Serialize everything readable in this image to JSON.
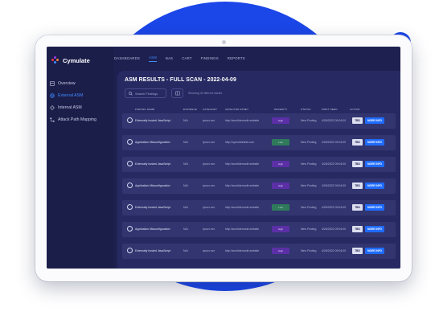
{
  "app": {
    "name": "Cymulate"
  },
  "colors": {
    "accent": "#3f8cff",
    "primary_button": "#1f6bff",
    "severity_high": "#5b2fa6",
    "severity_low": "#2f7a5b",
    "background_blob": "#1b46e8"
  },
  "sidebar": {
    "items": [
      {
        "label": "Overview",
        "icon": "overview-icon",
        "active": false
      },
      {
        "label": "External ASM",
        "icon": "external-asm-icon",
        "active": true
      },
      {
        "label": "Internal ASM",
        "icon": "internal-asm-icon",
        "active": false
      },
      {
        "label": "Attack Path Mapping",
        "icon": "attack-path-icon",
        "active": false
      }
    ]
  },
  "topnav": {
    "items": [
      {
        "label": "DASHBOARDS",
        "active": false
      },
      {
        "label": "ASM",
        "active": true
      },
      {
        "label": "BAS",
        "active": false
      },
      {
        "label": "CART",
        "active": false
      },
      {
        "label": "FINDINGS",
        "active": false
      },
      {
        "label": "REPORTS",
        "active": false
      }
    ]
  },
  "main": {
    "title": "ASM RESULTS - FULL SCAN - 2022-04-09",
    "search_placeholder": "Search Findings",
    "showing_text": "Showing 40 filtered results",
    "columns": [
      "FINDING NAME",
      "EVIDENCE",
      "CATEGORY",
      "AFFECTED ASSET",
      "SEVERITY",
      "STATUS",
      "FIRST SEEN",
      "ACTION"
    ],
    "rows": [
      {
        "name": "Externally hosted JavaScript",
        "evidence": "N/A",
        "category": "rpscn-rror",
        "asset": "http://scrolldemodir.website",
        "severity": "High",
        "severity_level": "high",
        "status": "New Finding",
        "first_seen": "4/26/2022 09:04:00",
        "tbd": "TBD",
        "more": "MORE INFO"
      },
      {
        "name": "Application Misconfiguration",
        "evidence": "N/A",
        "category": "rpscn-rror",
        "asset": "http://cymulatetest.com",
        "severity": "Low",
        "severity_level": "low",
        "status": "New Finding",
        "first_seen": "4/26/2022 09:04:00",
        "tbd": "TBD",
        "more": "MORE INFO"
      },
      {
        "name": "Externally hosted JavaScript",
        "evidence": "N/A",
        "category": "rpscn-rror",
        "asset": "http://scrolldemodir.website",
        "severity": "High",
        "severity_level": "high",
        "status": "New Finding",
        "first_seen": "4/26/2022 09:04:00",
        "tbd": "TBD",
        "more": "MORE INFO"
      },
      {
        "name": "Application Misconfiguration",
        "evidence": "N/A",
        "category": "rpscn-rror",
        "asset": "http://scrolldemodir.website",
        "severity": "High",
        "severity_level": "high",
        "status": "New Finding",
        "first_seen": "4/26/2022 09:04:00",
        "tbd": "TBD",
        "more": "MORE INFO"
      },
      {
        "name": "Externally hosted JavaScript",
        "evidence": "N/A",
        "category": "rpscn-rror",
        "asset": "http://scrolldemodir.website",
        "severity": "Low",
        "severity_level": "low",
        "status": "New Finding",
        "first_seen": "4/26/2022 09:04:00",
        "tbd": "TBD",
        "more": "MORE INFO"
      },
      {
        "name": "Application Misconfiguration",
        "evidence": "N/A",
        "category": "rpscn-rror",
        "asset": "http://scrolldemodir.website",
        "severity": "High",
        "severity_level": "high",
        "status": "New Finding",
        "first_seen": "4/26/2022 09:04:00",
        "tbd": "TBD",
        "more": "MORE INFO"
      },
      {
        "name": "Externally hosted JavaScript",
        "evidence": "N/A",
        "category": "rpscn-rror",
        "asset": "http://scrolldemodir.website",
        "severity": "High",
        "severity_level": "high",
        "status": "New Finding",
        "first_seen": "4/26/2022 09:04:00",
        "tbd": "TBD",
        "more": "MORE INFO"
      }
    ]
  }
}
